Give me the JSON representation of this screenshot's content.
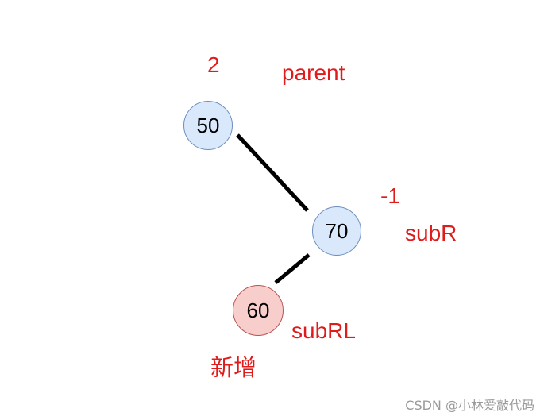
{
  "diagram": {
    "nodes": [
      {
        "id": "n50",
        "value": "50",
        "fill": "#dae8fc",
        "stroke": "#6c8ebf"
      },
      {
        "id": "n70",
        "value": "70",
        "fill": "#dae8fc",
        "stroke": "#6c8ebf"
      },
      {
        "id": "n60",
        "value": "60",
        "fill": "#f8cecc",
        "stroke": "#b85450"
      }
    ],
    "edges": [
      {
        "from": "n50",
        "to": "n70"
      },
      {
        "from": "n70",
        "to": "n60"
      }
    ],
    "labels": {
      "balance_50": "2",
      "name_50": "parent",
      "balance_70": "-1",
      "name_70": "subR",
      "name_60": "subRL",
      "new_node_tag": "新增"
    },
    "colors": {
      "label_text": "#e01b1b",
      "edge": "#000000"
    }
  },
  "watermark": "CSDN @小林爱敲代码"
}
